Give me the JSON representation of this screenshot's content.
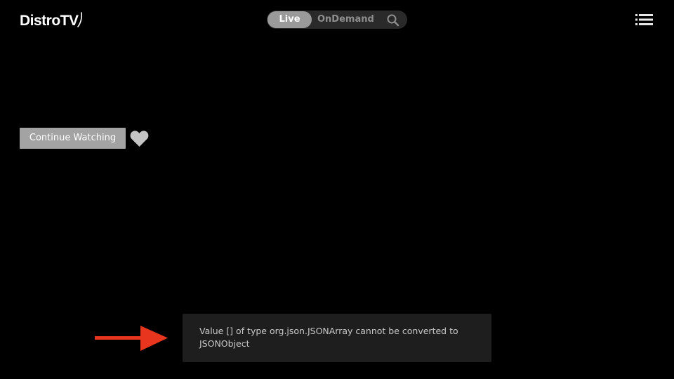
{
  "app": {
    "logo_text": "DistroTV"
  },
  "nav": {
    "tabs": [
      {
        "label": "Live",
        "active": true
      },
      {
        "label": "OnDemand",
        "active": false
      }
    ],
    "search_icon": "search-icon",
    "menu_icon": "list-menu-icon"
  },
  "main": {
    "continue_watching_label": "Continue Watching",
    "favorite_icon": "heart-icon"
  },
  "toast": {
    "message": "Value [] of type org.json.JSONArray cannot be converted to JSONObject"
  },
  "annotation": {
    "arrow_icon": "arrow-right-icon"
  },
  "colors": {
    "background": "#000000",
    "pill_bg": "#2a2a2a",
    "pill_active": "#9a9a9a",
    "button_bg": "#a3a3a3",
    "toast_bg": "#1e1e1e",
    "arrow": "#e8351e"
  }
}
